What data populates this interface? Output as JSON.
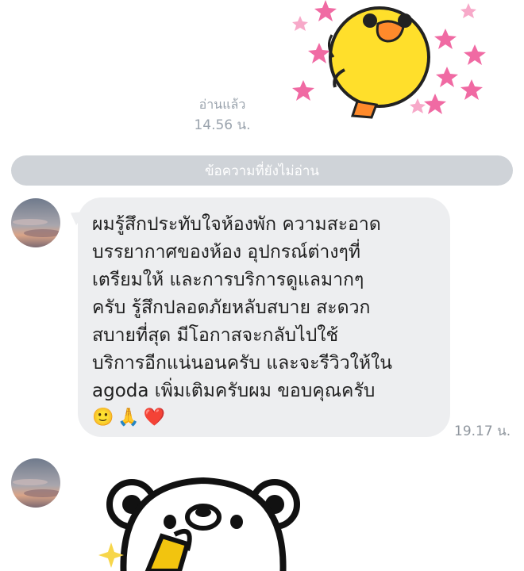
{
  "colors": {
    "bubble_bg": "#edeef0",
    "divider_bg": "#cfd3d8",
    "meta_text": "#9aa3ad",
    "duck_yellow": "#ffdf2b",
    "star_pink": "#f06aa3"
  },
  "outgoing": {
    "sticker_icon": "duck-sticker",
    "read_status": "อ่านแล้ว",
    "time": "14.56 น."
  },
  "divider": {
    "label": "ข้อความที่ยังไม่อ่าน"
  },
  "incoming_message": {
    "avatar_icon": "sunset-sky-avatar",
    "text": " ผมรู้สึกประทับใจห้องพัก ความสะอาด\nบรรยากาศของห้อง อุปกรณ์ต่างๆที่\nเตรียมให้ และการบริการดูแลมากๆ\nครับ รู้สึกปลอดภัยหลับสบาย สะดวก\nสบายที่สุด มีโอกาสจะกลับไปใช้\nบริการอีกแน่นอนครับ และจะรีวิวให้ใน\nagoda เพิ่มเติมครับผม ขอบคุณครับ",
    "emojis": [
      "🙂",
      "🙏",
      "❤️"
    ],
    "time": "19.17 น."
  },
  "incoming_sticker": {
    "avatar_icon": "sunset-sky-avatar",
    "sticker_icon": "white-bear-trophy-sticker"
  }
}
